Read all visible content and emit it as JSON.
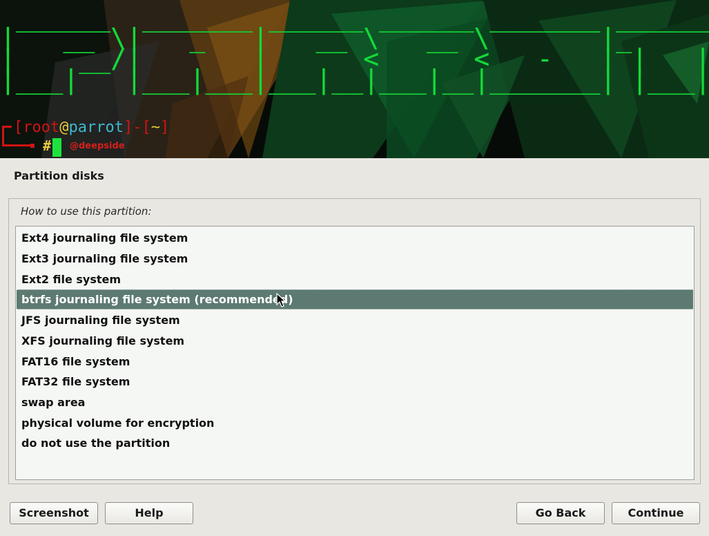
{
  "banner": {
    "logo_ascii": " ______  _______ ______ ______ _______ _______ _______ _______\n|   __ \\|   _   |   __ \\   __ \\       |_     _|       |     __|\n|    __/|       |      <      <   -   | |   | |   -   |__     |\n|___|   |___|___|___|__|___|__|_______| |___| |_______|_______|",
    "prompt": {
      "open_bracket": "[",
      "user": "root",
      "at": "@",
      "host": "parrot",
      "close_bracket": "]",
      "dash": "-",
      "dir_open": "[",
      "dir": "~",
      "dir_close": "]",
      "hash": "#"
    },
    "handle": "@deepside",
    "colors": {
      "background": "#070b07",
      "logo_green": "#16d93a",
      "prompt_red": "#d01414",
      "prompt_yellow": "#e8c93a",
      "prompt_cyan": "#3fb7d0"
    }
  },
  "page": {
    "title": "Partition disks",
    "question": "How to use this partition:"
  },
  "list": {
    "items": [
      {
        "label": "Ext4 journaling file system",
        "selected": false
      },
      {
        "label": "Ext3 journaling file system",
        "selected": false
      },
      {
        "label": "Ext2 file system",
        "selected": false
      },
      {
        "label": "btrfs journaling file system (recommended)",
        "selected": true
      },
      {
        "label": "JFS journaling file system",
        "selected": false
      },
      {
        "label": "XFS journaling file system",
        "selected": false
      },
      {
        "label": "FAT16 file system",
        "selected": false
      },
      {
        "label": "FAT32 file system",
        "selected": false
      },
      {
        "label": "swap area",
        "selected": false
      },
      {
        "label": "physical volume for encryption",
        "selected": false
      },
      {
        "label": "do not use the partition",
        "selected": false
      }
    ],
    "selected_color": "#5d7a72"
  },
  "buttons": {
    "screenshot": "Screenshot",
    "help": "Help",
    "go_back": "Go Back",
    "continue": "Continue"
  },
  "icons": {
    "mouse_cursor": "arrow-pointer-icon"
  }
}
